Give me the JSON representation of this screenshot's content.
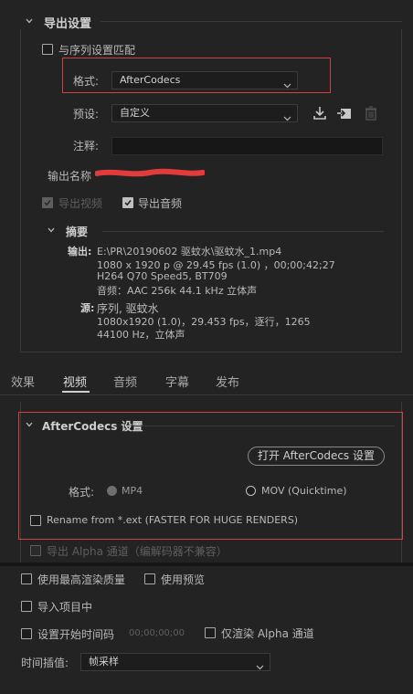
{
  "export_settings": {
    "title": "导出设置",
    "match_sequence_label": "与序列设置匹配",
    "format_label": "格式:",
    "format_value": "AfterCodecs",
    "preset_label": "预设:",
    "preset_value": "自定义",
    "comment_label": "注释:",
    "comment_value": "",
    "output_name_label": "输出名称",
    "export_video_label": "导出视频",
    "export_audio_label": "导出音频",
    "summary": {
      "title": "摘要",
      "output_label": "输出:",
      "output_lines": [
        "E:\\PR\\20190602 驱蚊水\\驱蚊水_1.mp4",
        "1080 x 1920 p @ 29.45 fps (1.0) ，00;00;42;27",
        "H264 Q70 Speed5, BT709",
        "音频：AAC 256k 44.1 kHz 立体声"
      ],
      "source_label": "源:",
      "source_lines": [
        "序列, 驱蚊水",
        "1080x1920 (1.0)，29.453 fps，逐行，1265",
        "44100 Hz，立体声"
      ]
    }
  },
  "tabs": [
    {
      "label": "效果"
    },
    {
      "label": "视频"
    },
    {
      "label": "音频"
    },
    {
      "label": "字幕"
    },
    {
      "label": "发布"
    }
  ],
  "aftercodecs": {
    "title": "AfterCodecs 设置",
    "open_button_label": "打开 AfterCodecs 设置",
    "format_label": "格式:",
    "option_mp4": "MP4",
    "option_mov": "MOV (Quicktime)",
    "rename_label": "Rename from *.ext (FASTER FOR HUGE RENDERS)",
    "alpha_label": "导出 Alpha 通道（编解码器不兼容）"
  },
  "bottom": {
    "max_quality_label": "使用最高渲染质量",
    "use_previews_label": "使用预览",
    "import_project_label": "导入项目中",
    "set_start_tc_label": "设置开始时间码",
    "start_tc_value": "00;00;00;00",
    "render_alpha_only_label": "仅渲染 Alpha 通道",
    "time_interp_label": "时间插值:",
    "time_interp_value": "帧采样"
  },
  "colors": {
    "background": "#232323",
    "highlight_box": "#d24141",
    "text": "#b9b9b9"
  }
}
